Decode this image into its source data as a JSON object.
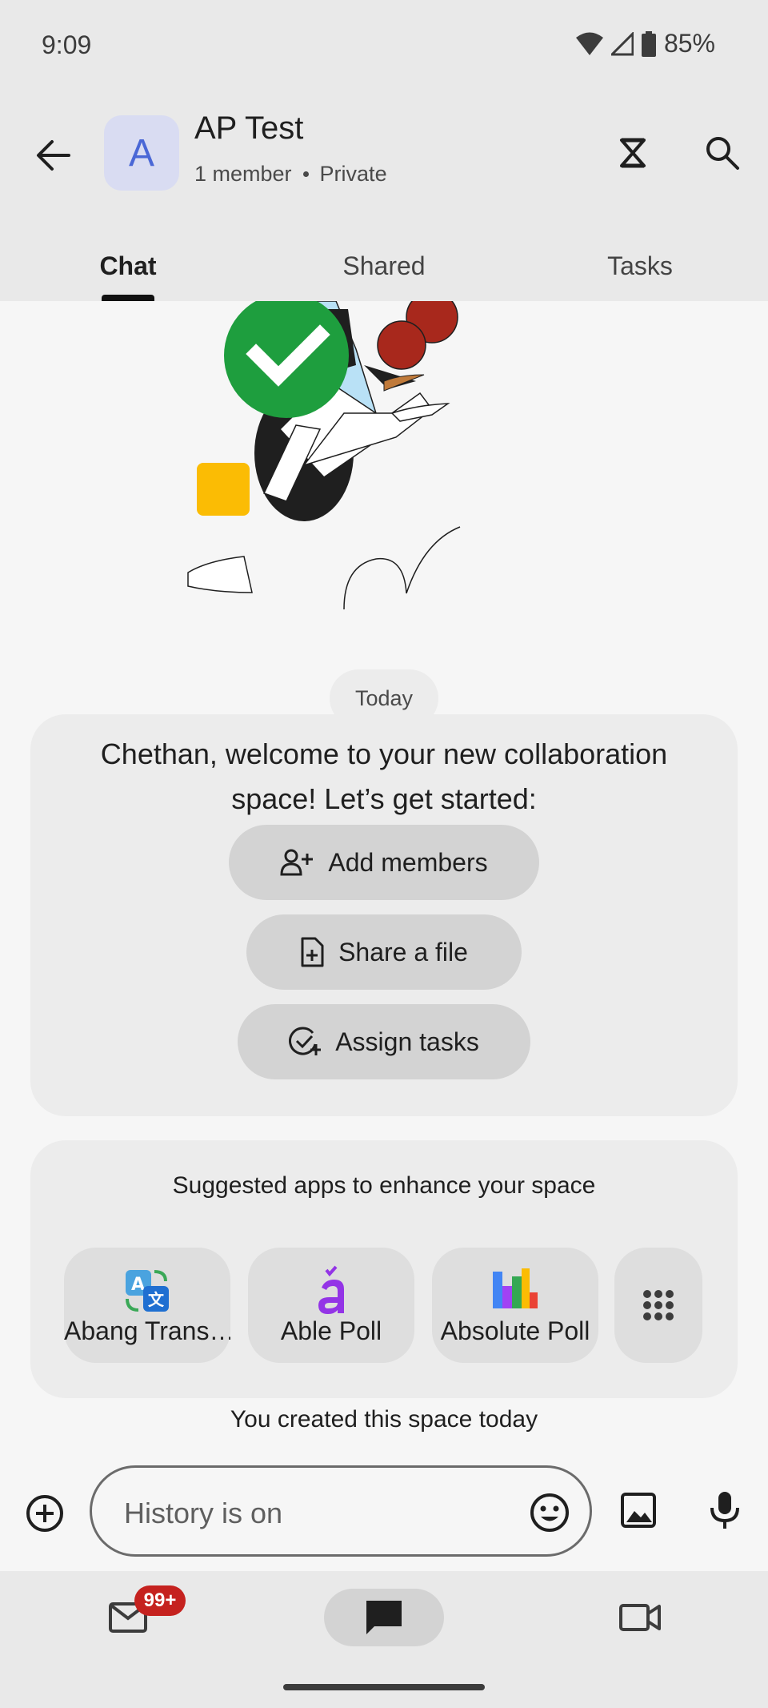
{
  "status": {
    "time": "9:09",
    "battery": "85%"
  },
  "header": {
    "avatar_letter": "A",
    "title": "AP Test",
    "members": "1 member",
    "visibility": "Private"
  },
  "tabs": [
    {
      "label": "Chat",
      "active": true
    },
    {
      "label": "Shared",
      "active": false
    },
    {
      "label": "Tasks",
      "active": false
    }
  ],
  "chat": {
    "date_chip": "Today",
    "welcome": {
      "message": "Chethan, welcome to your new collaboration space! Let’s get started:",
      "actions": [
        {
          "label": "Add members",
          "icon": "person-add-icon"
        },
        {
          "label": "Share a file",
          "icon": "file-add-icon"
        },
        {
          "label": "Assign tasks",
          "icon": "task-add-icon"
        }
      ]
    },
    "apps": {
      "title": "Suggested apps to enhance your space",
      "items": [
        {
          "name": "Abang Trans…",
          "icon": "translate-icon"
        },
        {
          "name": "Able Poll",
          "icon": "able-poll-icon"
        },
        {
          "name": "Absolute Poll",
          "icon": "bar-chart-icon"
        }
      ],
      "more_icon": "apps-grid-icon"
    },
    "created_note": "You created this space today"
  },
  "composer": {
    "placeholder": "History is on"
  },
  "bottom_nav": {
    "mail_badge": "99+"
  },
  "colors": {
    "header_bg": "#e9e9e9",
    "avatar_bg": "#d9dcf2",
    "avatar_fg": "#4a67d6",
    "badge": "#c5221f",
    "check_green": "#1e9e3e"
  }
}
